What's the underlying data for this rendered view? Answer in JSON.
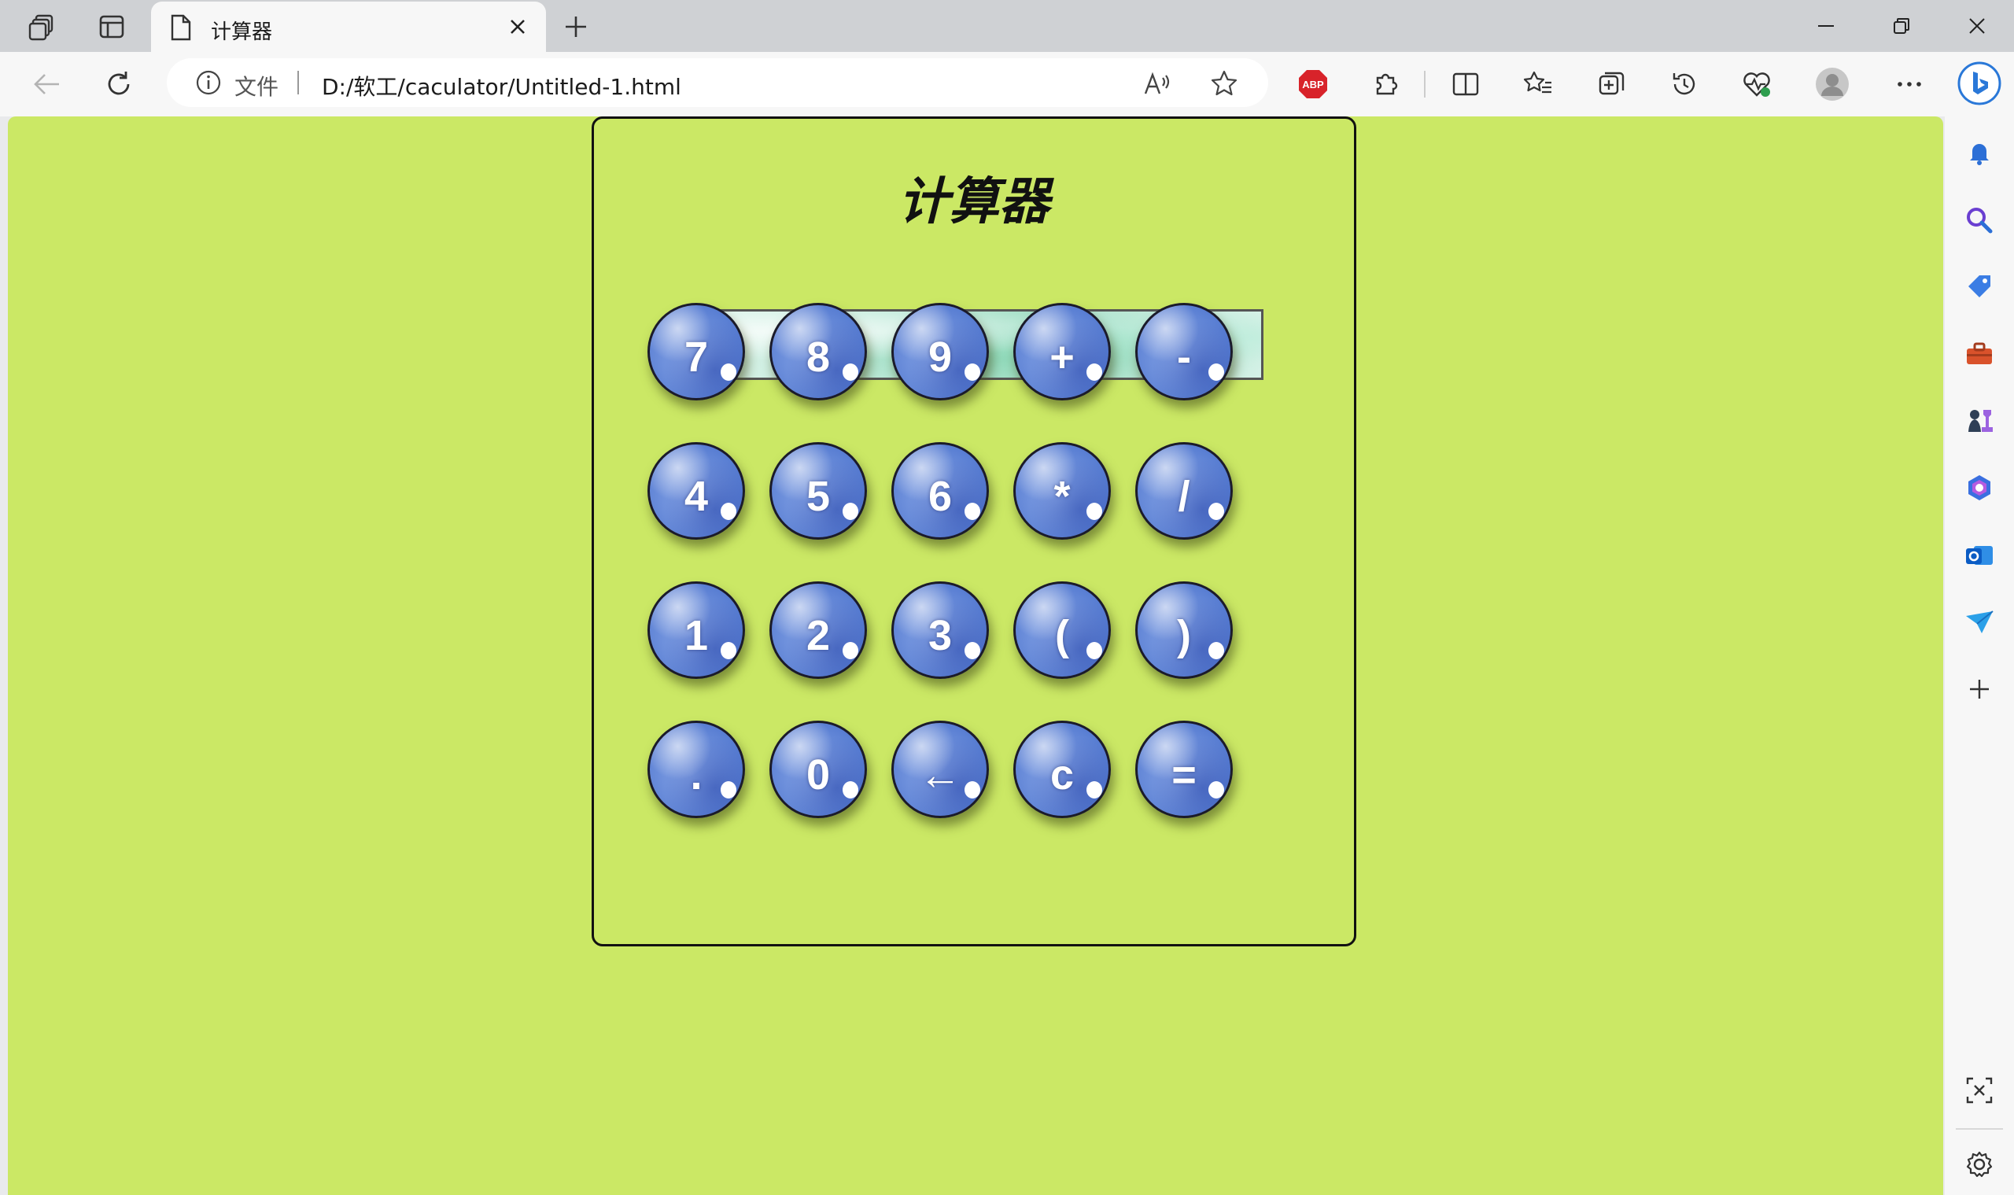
{
  "browser": {
    "tab": {
      "title": "计算器"
    },
    "address_bar": {
      "scheme_label": "文件",
      "url": "D:/软工/caculator/Untitled-1.html"
    },
    "extensions": {
      "adblock_badge": "ABP"
    }
  },
  "page": {
    "background_color": "#cbe865",
    "calculator": {
      "title": "计算器",
      "display_value": "",
      "buttons": [
        [
          "7",
          "8",
          "9",
          "+",
          "-"
        ],
        [
          "4",
          "5",
          "6",
          "*",
          "/"
        ],
        [
          "1",
          "2",
          "3",
          "(",
          ")"
        ],
        [
          ".",
          "0",
          "←",
          "c",
          "="
        ]
      ]
    }
  }
}
